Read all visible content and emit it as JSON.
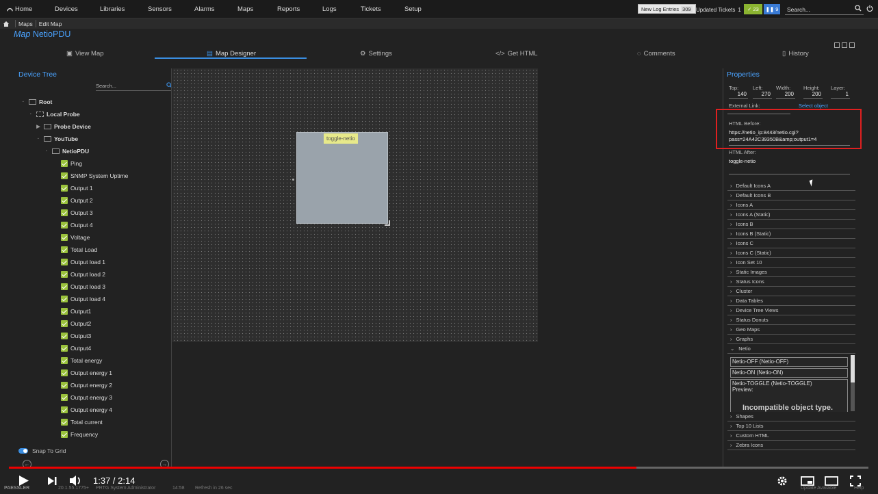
{
  "nav": {
    "home": "Home",
    "items": [
      "Devices",
      "Libraries",
      "Sensors",
      "Alarms",
      "Maps",
      "Reports",
      "Logs",
      "Tickets",
      "Setup"
    ],
    "log_entries_label": "New Log Entries",
    "log_entries_count": "309",
    "updated_tickets_label": "Updated Tickets",
    "updated_tickets_count": "1",
    "badge_green": "23",
    "badge_blue": "9",
    "search_placeholder": "Search..."
  },
  "breadcrumb": [
    "Maps",
    "Edit Map"
  ],
  "title": {
    "prefix": "Map",
    "name": "NetioPDU"
  },
  "tabs": [
    "View Map",
    "Map Designer",
    "Settings",
    "Get HTML",
    "Comments",
    "History"
  ],
  "device_tree": {
    "title": "Device Tree",
    "search_placeholder": "Search...",
    "nodes": [
      "Root",
      "Local Probe",
      "Probe Device",
      "YouTube",
      "NetioPDU"
    ],
    "sensors": [
      "Ping",
      "SNMP System Uptime",
      "Output 1",
      "Output 2",
      "Output 3",
      "Output 4",
      "Voltage",
      "Total Load",
      "Output load 1",
      "Output load 2",
      "Output load 3",
      "Output load 4",
      "Output1",
      "Output2",
      "Output3",
      "Output4",
      "Total energy",
      "Output energy 1",
      "Output energy 2",
      "Output energy 3",
      "Output energy 4",
      "Total current",
      "Frequency"
    ],
    "snap_label": "Snap To Grid"
  },
  "canvas": {
    "object_label": "toggle-netio"
  },
  "properties": {
    "title": "Properties",
    "top_label": "Top:",
    "top": "140",
    "left_label": "Left:",
    "left": "270",
    "width_label": "Width:",
    "width": "200",
    "height_label": "Height:",
    "height": "200",
    "layer_label": "Layer:",
    "layer": "1",
    "external_link_label": "External Link:",
    "select_object": "Select object",
    "html_before_label": "HTML Before:",
    "html_before_1": "https://netio_ip:8443/netio.cgi?",
    "html_before_2": "pass=24A42C39350B&amp;output1=4",
    "html_after_label": "HTML After:",
    "html_after": "toggle-netio",
    "groups": [
      "Default Icons A",
      "Default Icons B",
      "Icons A",
      "Icons A (Static)",
      "Icons B",
      "Icons B (Static)",
      "Icons C",
      "Icons C (Static)",
      "Icon Set 10",
      "Static Images",
      "Status Icons",
      "Cluster",
      "Data Tables",
      "Device Tree Views",
      "Status Donuts",
      "Geo Maps",
      "Graphs",
      "Netio"
    ],
    "groups_after": [
      "Shapes",
      "Top 10 Lists",
      "Custom HTML",
      "Zebra Icons"
    ],
    "netio_items": [
      "Netio-OFF (Netio-OFF)",
      "Netio-ON (Netio-ON)",
      "Netio-TOGGLE (Netio-TOGGLE)"
    ],
    "preview_label": "Preview:",
    "incompatible": "Incompatible object type."
  },
  "video": {
    "time": "1:37 / 2:14",
    "progress": 0.73
  },
  "footer": {
    "brand": "PAESSLER",
    "version": "20.1.55.1775+",
    "user": "PRTG System Administrator",
    "clock": "14:58",
    "refresh": "Refresh in 26 sec",
    "update": "Update Available",
    "help": "Help"
  }
}
